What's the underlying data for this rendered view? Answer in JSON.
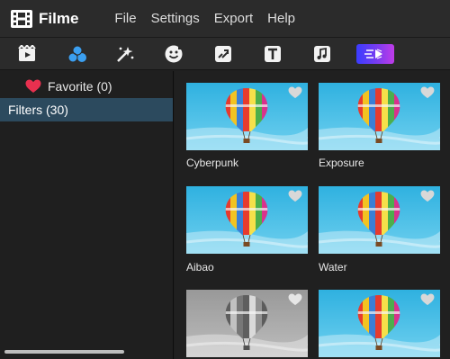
{
  "app": {
    "name": "Filme"
  },
  "menu": {
    "items": [
      "File",
      "Settings",
      "Export",
      "Help"
    ]
  },
  "toolbar": {
    "tools": [
      "media-icon",
      "filters-icon",
      "effects-icon",
      "sticker-icon",
      "transition-icon",
      "text-icon",
      "music-icon",
      "premium-icon"
    ]
  },
  "sidebar": {
    "items": [
      {
        "label": "Favorite (0)",
        "icon": "heart-icon"
      },
      {
        "label": "Filters (30)",
        "selected": true
      }
    ]
  },
  "filters": [
    {
      "name": "Cyberpunk",
      "variant": "color"
    },
    {
      "name": "Exposure",
      "variant": "color"
    },
    {
      "name": "Aibao",
      "variant": "color"
    },
    {
      "name": "Water",
      "variant": "color"
    },
    {
      "name": "",
      "variant": "grayscale"
    },
    {
      "name": "",
      "variant": "color"
    }
  ],
  "colors": {
    "accent": "#2c4a5e",
    "favorite_heart": "#e8304f",
    "filters_icon": "#3b9ff0",
    "sky": "#38b6e0"
  }
}
